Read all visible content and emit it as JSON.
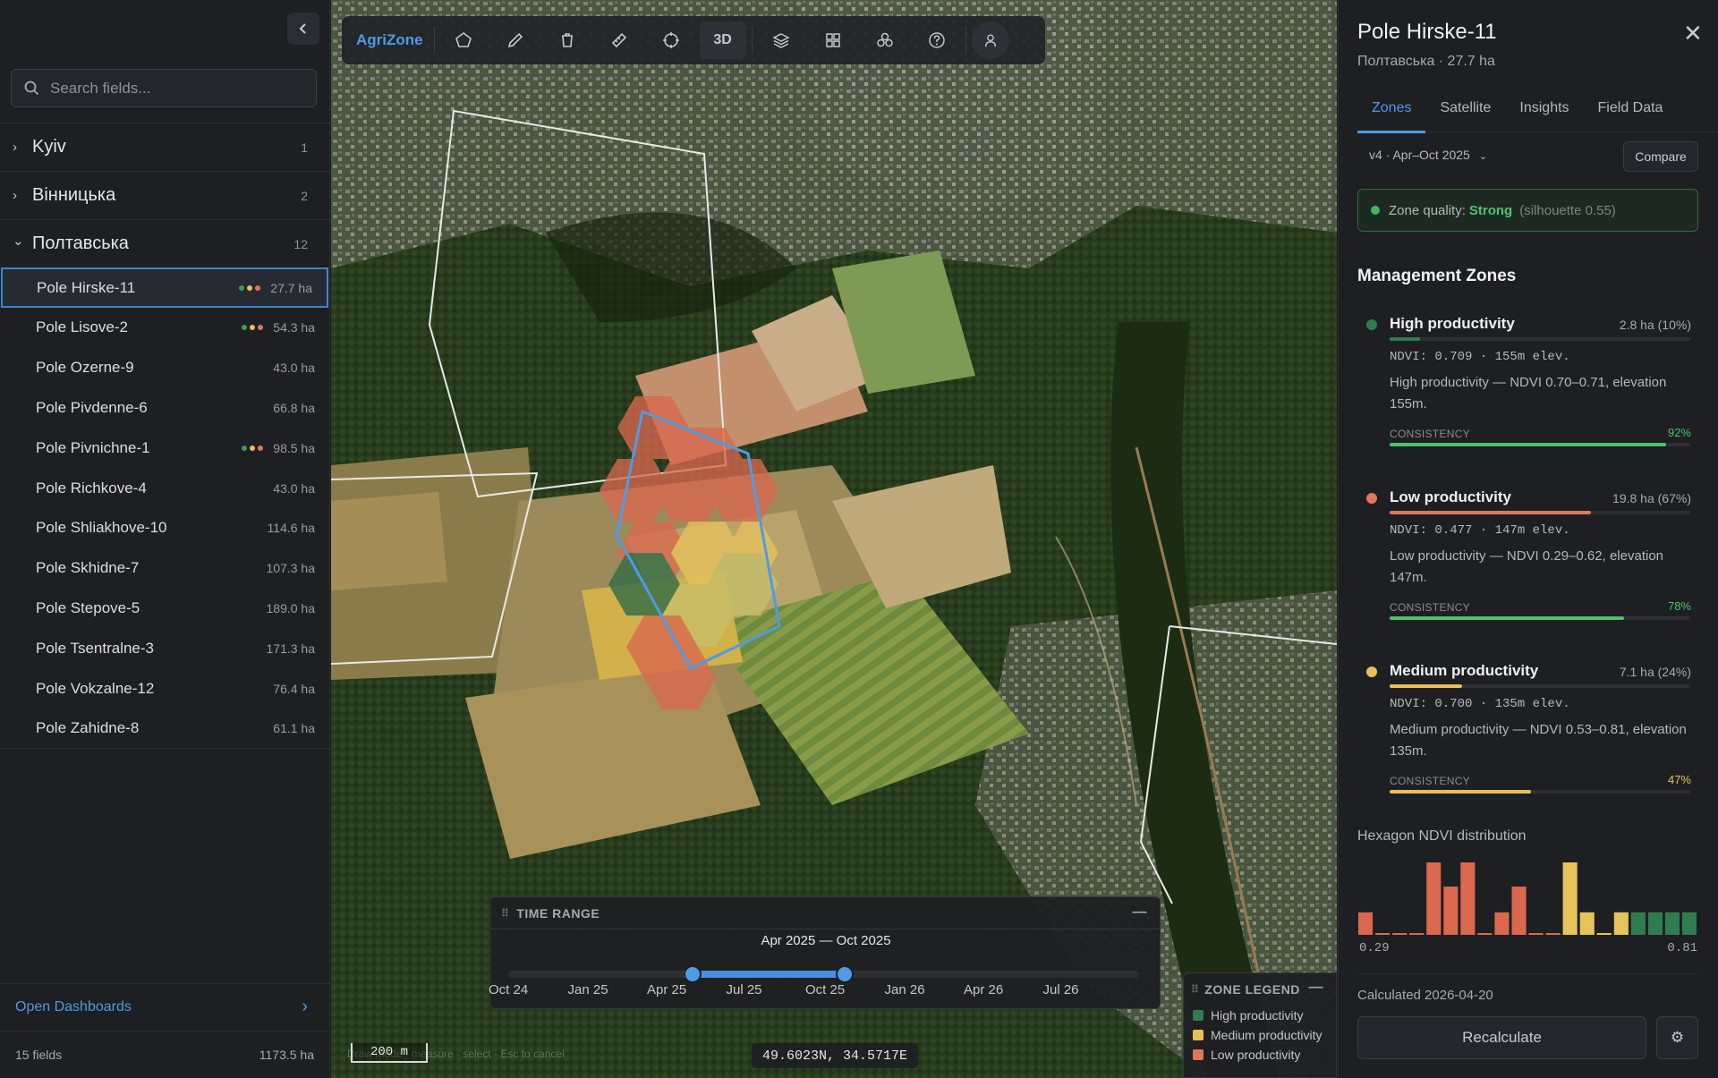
{
  "sidebar": {
    "search_placeholder": "Search fields...",
    "regions": [
      {
        "name": "Kyiv",
        "count": "1",
        "expanded": false
      },
      {
        "name": "Вінницька",
        "count": "2",
        "expanded": false
      },
      {
        "name": "Полтавська",
        "count": "12",
        "expanded": true
      }
    ],
    "fields": [
      {
        "name": "Pole Hirske-11",
        "area": "27.7 ha",
        "selected": true,
        "dots": [
          "#3d9a5c",
          "#e8c05a",
          "#e2765c"
        ]
      },
      {
        "name": "Pole Lisove-2",
        "area": "54.3 ha",
        "selected": false,
        "dots": [
          "#3d9a5c",
          "#e8c05a",
          "#e2765c"
        ]
      },
      {
        "name": "Pole Ozerne-9",
        "area": "43.0 ha",
        "selected": false,
        "dots": []
      },
      {
        "name": "Pole Pivdenne-6",
        "area": "66.8 ha",
        "selected": false,
        "dots": []
      },
      {
        "name": "Pole Pivnichne-1",
        "area": "98.5 ha",
        "selected": false,
        "dots": [
          "#3d9a5c",
          "#e8c05a",
          "#e2765c"
        ]
      },
      {
        "name": "Pole Richkove-4",
        "area": "43.0 ha",
        "selected": false,
        "dots": []
      },
      {
        "name": "Pole Shliakhove-10",
        "area": "114.6 ha",
        "selected": false,
        "dots": []
      },
      {
        "name": "Pole Skhidne-7",
        "area": "107.3 ha",
        "selected": false,
        "dots": []
      },
      {
        "name": "Pole Stepove-5",
        "area": "189.0 ha",
        "selected": false,
        "dots": []
      },
      {
        "name": "Pole Tsentralne-3",
        "area": "171.3 ha",
        "selected": false,
        "dots": []
      },
      {
        "name": "Pole Vokzalne-12",
        "area": "76.4 ha",
        "selected": false,
        "dots": []
      },
      {
        "name": "Pole Zahidne-8",
        "area": "61.1 ha",
        "selected": false,
        "dots": []
      }
    ],
    "open_dashboards": "Open Dashboards",
    "footer_count": "15 fields",
    "footer_area": "1173.5 ha"
  },
  "toolbar": {
    "brand": "AgriZone",
    "mode_3d": "3D",
    "icons": [
      "polygon-icon",
      "pencil-icon",
      "trash-icon",
      "ruler-icon",
      "crosshair-icon",
      "3d-toggle",
      "layers-icon",
      "grid-icon",
      "cluster-icon",
      "help-icon",
      "user-icon"
    ]
  },
  "map": {
    "scale_label": "200 m",
    "attribution": "Draw mode · measure · select · Esc to cancel",
    "coords": "49.6023N, 34.5717E"
  },
  "time_range": {
    "title": "TIME RANGE",
    "range_label": "Apr 2025 — Oct 2025",
    "ticks": [
      "Oct 24",
      "Jan 25",
      "Apr 25",
      "Jul 25",
      "Oct 25",
      "Jan 26",
      "Apr 26",
      "Jul 26"
    ],
    "start": "Apr 25",
    "end": "Oct 25"
  },
  "zone_legend": {
    "title": "ZONE LEGEND",
    "items": [
      {
        "label": "High productivity",
        "color": "#2f7d4f"
      },
      {
        "label": "Medium productivity",
        "color": "#e8c05a"
      },
      {
        "label": "Low productivity",
        "color": "#e2765c"
      }
    ]
  },
  "detail": {
    "title": "Pole Hirske-11",
    "subtitle": "Полтавська · 27.7 ha",
    "tabs": [
      "Zones",
      "Satellite",
      "Insights",
      "Field Data"
    ],
    "active_tab": "Zones",
    "version": "v4 · Apr–Oct 2025",
    "compare": "Compare",
    "quality_prefix": "Zone quality:",
    "quality_value": "Strong",
    "quality_note": "(silhouette 0.55)",
    "zones_title": "Management Zones",
    "zones": [
      {
        "name": "High productivity",
        "area": "2.8 ha (10%)",
        "share": 0.1,
        "color": "#2f7d4f",
        "stats": "NDVI: 0.709 · 155m elev.",
        "desc": "High productivity — NDVI 0.70–0.71, elevation 155m.",
        "consistency_label": "CONSISTENCY",
        "consistency": "92%",
        "consistency_value": 0.92,
        "cons_color": "#4cc46a"
      },
      {
        "name": "Low productivity",
        "area": "19.8 ha (67%)",
        "share": 0.67,
        "color": "#e2765c",
        "stats": "NDVI: 0.477 · 147m elev.",
        "desc": "Low productivity — NDVI 0.29–0.62, elevation 147m.",
        "consistency_label": "CONSISTENCY",
        "consistency": "78%",
        "consistency_value": 0.78,
        "cons_color": "#4cc46a"
      },
      {
        "name": "Medium productivity",
        "area": "7.1 ha (24%)",
        "share": 0.24,
        "color": "#e8c05a",
        "stats": "NDVI: 0.700 · 135m elev.",
        "desc": "Medium productivity — NDVI 0.53–0.81, elevation 135m.",
        "consistency_label": "CONSISTENCY",
        "consistency": "47%",
        "consistency_value": 0.47,
        "cons_color": "#e8c05a"
      }
    ],
    "histogram_title": "Hexagon NDVI distribution",
    "hist_min": "0.29",
    "hist_max": "0.81",
    "calculated": "Calculated 2026-04-20",
    "recalculate": "Recalculate"
  },
  "chart_data": {
    "type": "bar",
    "title": "Hexagon NDVI distribution",
    "xlim": [
      0.29,
      0.81
    ],
    "bins": [
      {
        "value": 0.28,
        "zone": "low"
      },
      {
        "value": 0.02,
        "zone": "low"
      },
      {
        "value": 0.02,
        "zone": "low"
      },
      {
        "value": 0.02,
        "zone": "low"
      },
      {
        "value": 0.9,
        "zone": "low"
      },
      {
        "value": 0.6,
        "zone": "low"
      },
      {
        "value": 0.9,
        "zone": "low"
      },
      {
        "value": 0.02,
        "zone": "low"
      },
      {
        "value": 0.28,
        "zone": "low"
      },
      {
        "value": 0.6,
        "zone": "low"
      },
      {
        "value": 0.02,
        "zone": "low"
      },
      {
        "value": 0.02,
        "zone": "low"
      },
      {
        "value": 0.9,
        "zone": "medium"
      },
      {
        "value": 0.28,
        "zone": "medium"
      },
      {
        "value": 0.02,
        "zone": "medium"
      },
      {
        "value": 0.28,
        "zone": "medium"
      },
      {
        "value": 0.28,
        "zone": "high"
      },
      {
        "value": 0.28,
        "zone": "high"
      },
      {
        "value": 0.28,
        "zone": "high"
      },
      {
        "value": 0.28,
        "zone": "high"
      }
    ]
  }
}
